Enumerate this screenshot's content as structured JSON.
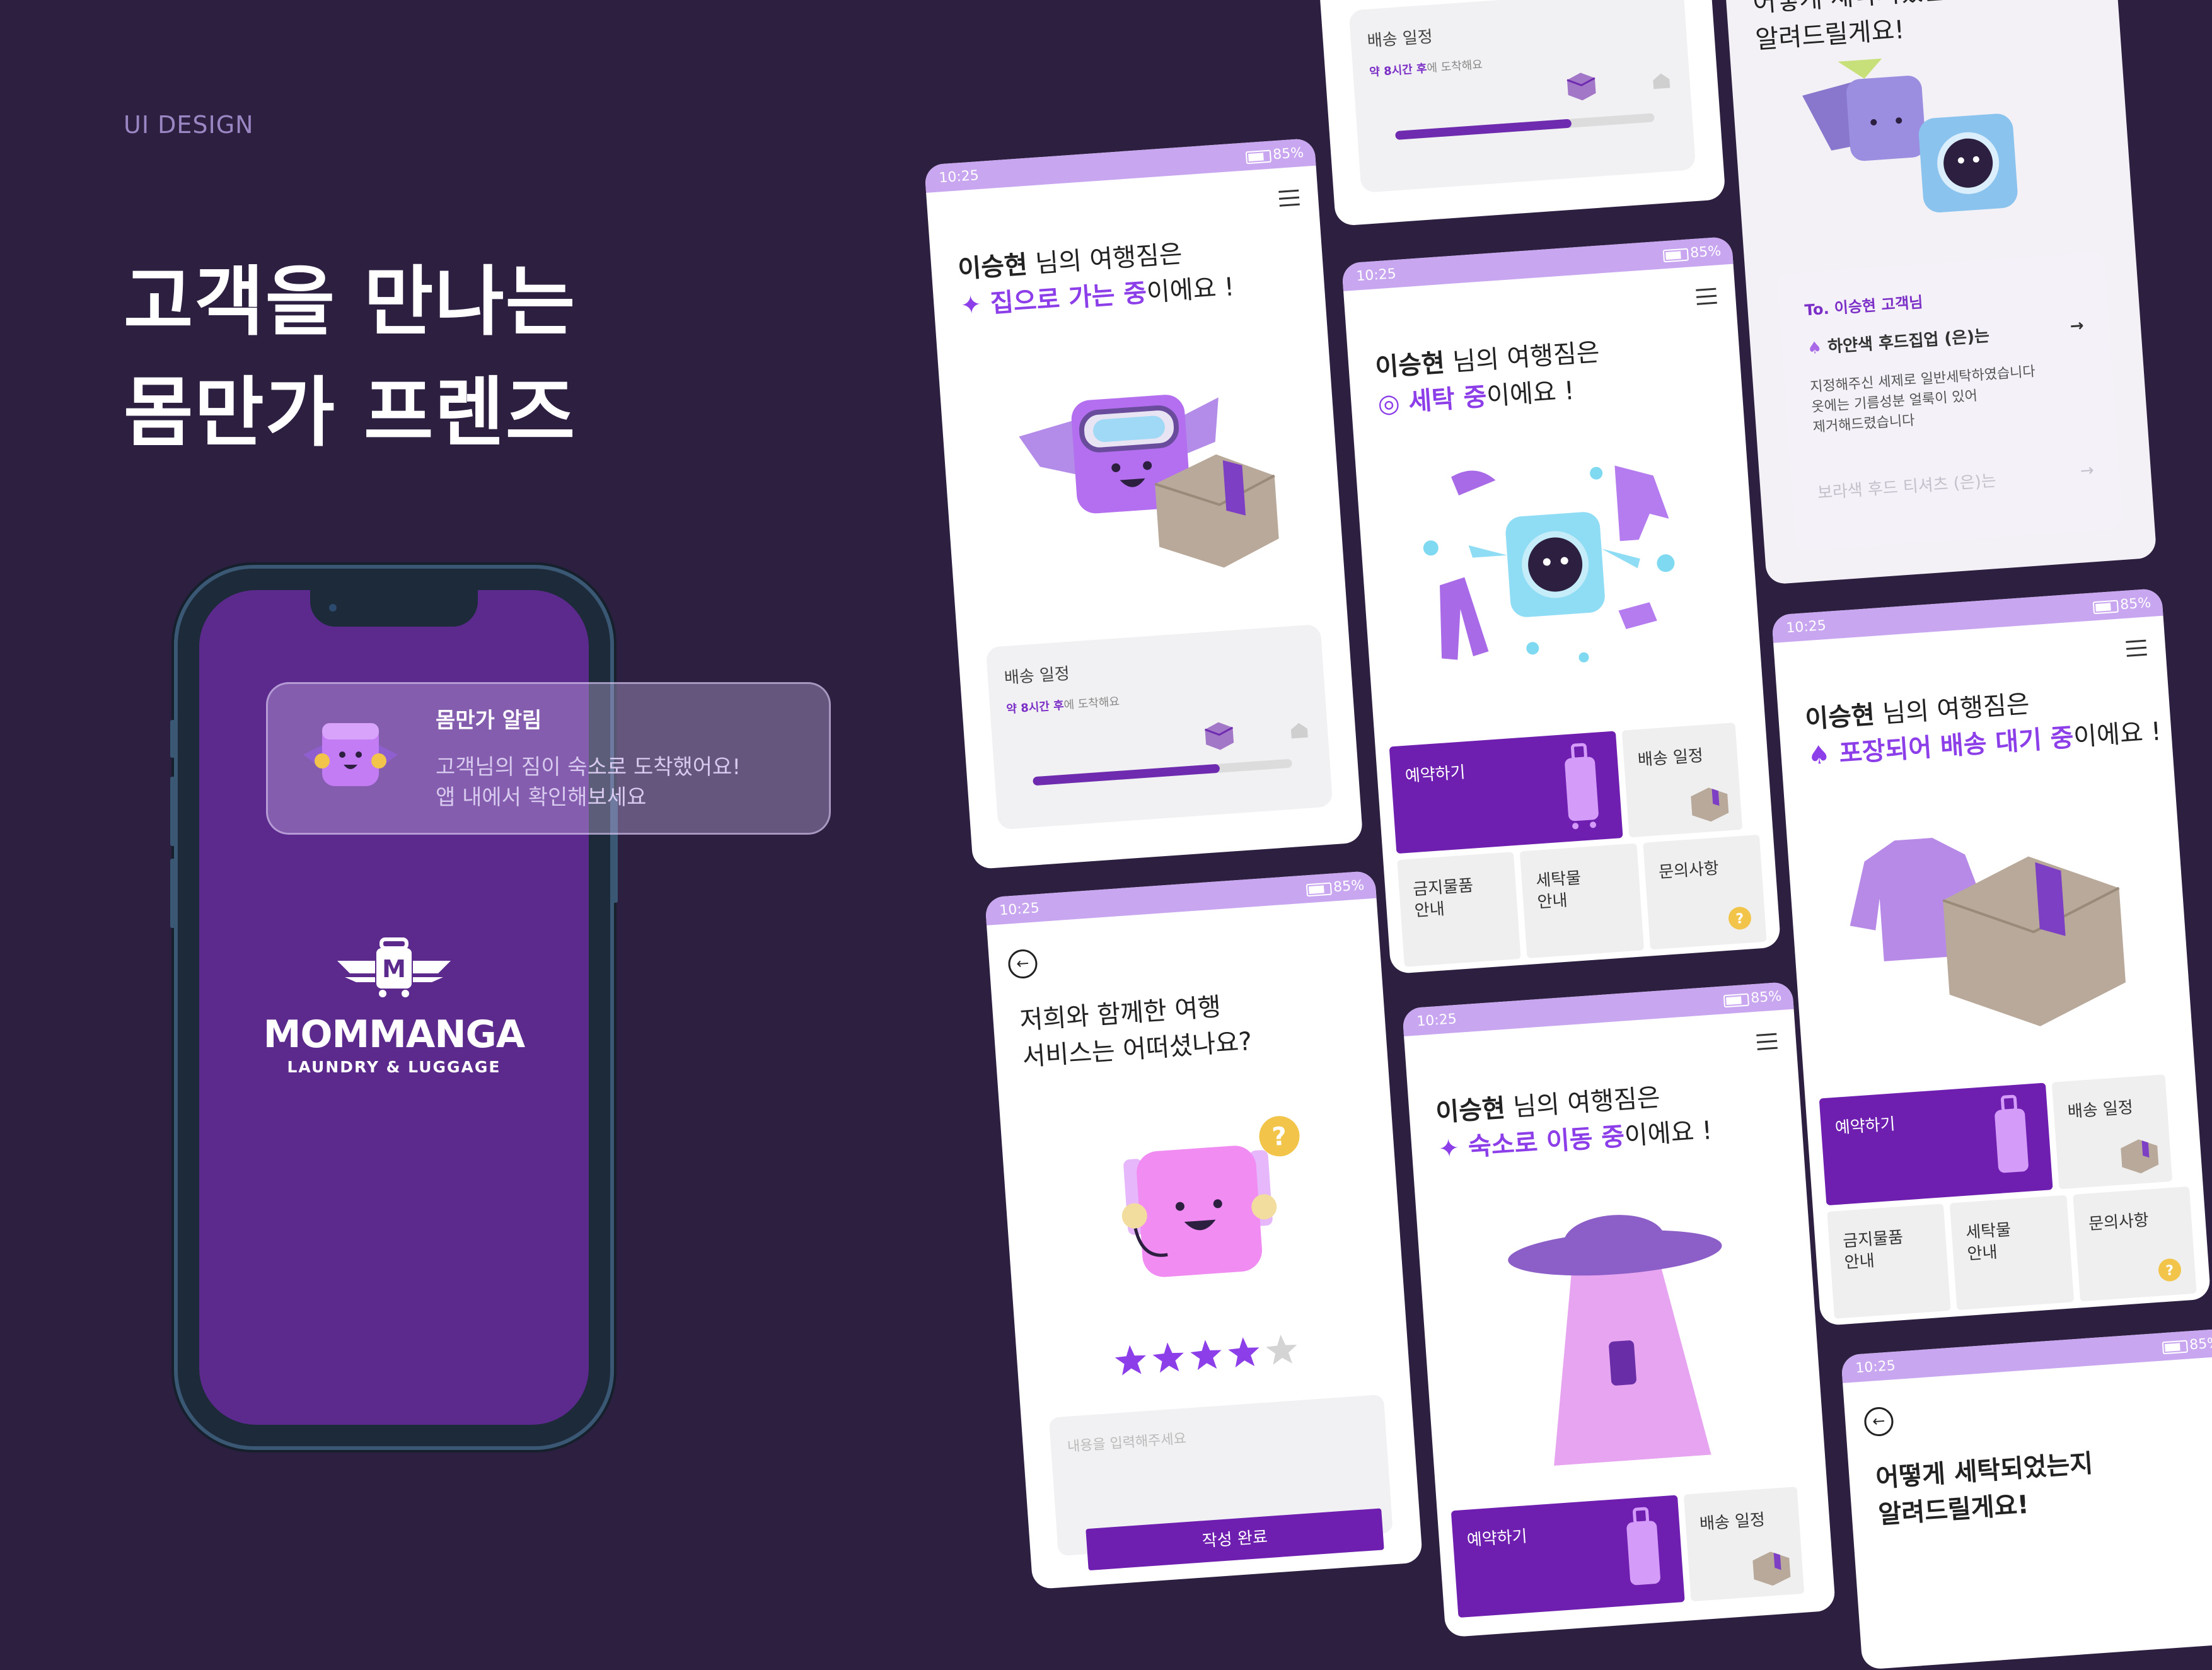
{
  "section_label": "UI DESIGN",
  "headline": [
    "고객을 만나는",
    "몸만가 프렌즈"
  ],
  "colors": {
    "background": "#2c1f40",
    "brand": "#6f1fb0",
    "accent": "#8c3ee8",
    "status_bar": "#c9a6f0"
  },
  "phone": {
    "notification": {
      "title": "몸만가 알림",
      "body_line1": "고객님의 짐이 숙소로 도착했어요!",
      "body_line2": "앱 내에서 확인해보세요"
    },
    "logo": {
      "name": "MOMMANGA",
      "sub": "LAUNDRY & LUGGAGE",
      "letter": "M"
    }
  },
  "status": {
    "time": "10:25",
    "battery": "85%"
  },
  "cards": {
    "home": {
      "user": "이승현",
      "line1_rest": " 님의 여행짐은",
      "status_hl": "집으로 가는 중",
      "status_rest": "이에요 !",
      "schedule_title": "배송 일정",
      "schedule_eta": "약 8시간 후",
      "schedule_eta_rest": "에 도착해요",
      "progress": 0.72
    },
    "top_sched": {
      "schedule_title": "배송 일정",
      "schedule_eta": "약 8시간 후",
      "schedule_eta_rest": "에 도착해요",
      "progress": 0.68
    },
    "laundry": {
      "user": "이승현",
      "line1_rest": " 님의 여행짐은",
      "status_hl": "세탁 중",
      "status_rest": "이에요 !",
      "tiles": [
        "예약하기",
        "배송 일정",
        "금지물품\n안내",
        "세탁물\n안내",
        "문의사항"
      ]
    },
    "review": {
      "q_line1": "저희와 함께한 여행",
      "q_line2": "서비스는 어떠셨나요?",
      "rating": 4,
      "max_rating": 5,
      "placeholder": "내용을 입력해주세요",
      "submit": "작성 완료"
    },
    "moving": {
      "user": "이승현",
      "line1_rest": " 님의 여행짐은",
      "status_hl": "숙소로 이동 중",
      "status_rest": "이에요 !",
      "tiles": [
        "예약하기",
        "배송 일정"
      ]
    },
    "feedback": {
      "heading_line1": "어떻게 세탁되었는지",
      "heading_line2": "알려드릴게요!",
      "to": "To. 이승현 고객님",
      "item1_title": "하얀색 후드집업 (은)는",
      "item1_l1": "지정해주신 세제로 일반세탁하였습니다",
      "item1_l2": "옷에는 기름성분 얼룩이 있어",
      "item1_l3": "제거해드렸습니다",
      "item2_title": "보라색 후드 티셔츠 (은)는"
    },
    "packed": {
      "user": "이승현",
      "line1_rest": " 님의 여행짐은",
      "status_hl": "포장되어 배송 대기 중",
      "status_rest": "이에요 !",
      "tiles": [
        "예약하기",
        "배송 일정",
        "금지물품\n안내",
        "세탁물\n안내",
        "문의사항"
      ]
    },
    "howwashed": {
      "heading_line1": "어떻게 세탁되었는지",
      "heading_line2": "알려드릴게요!"
    }
  }
}
